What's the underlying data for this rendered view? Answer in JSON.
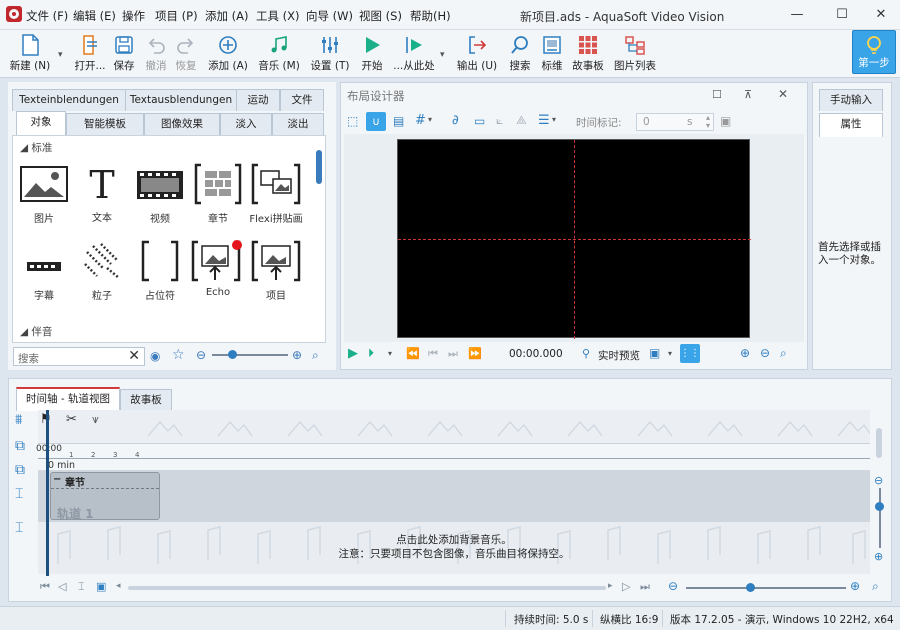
{
  "menu": [
    "文件 (F)",
    "编辑 (E)",
    "操作",
    "项目 (P)",
    "添加 (A)",
    "工具 (X)",
    "向导 (W)",
    "视图 (S)",
    "帮助(H)"
  ],
  "window_title": "新项目.ads - AquaSoft Video Vision",
  "toolbar": {
    "new": "新建 (N)",
    "open": "打开...",
    "save": "保存",
    "undo": "撤消",
    "redo": "恢复",
    "add": "添加 (A)",
    "music": "音乐 (M)",
    "settings": "设置 (T)",
    "start": "开始",
    "from_here": "...从此处",
    "export": "输出 (U)",
    "search": "搜索",
    "marker": "标维",
    "storyboard": "故事板",
    "photo_list": "图片列表",
    "first_step": "第一步"
  },
  "objects_panel": {
    "top_tabs": [
      "Texteinblendungen",
      "Textausblendungen",
      "运动",
      "文件"
    ],
    "bottom_tabs": [
      "对象",
      "智能模板",
      "图像效果",
      "淡入",
      "淡出"
    ],
    "section_standard": "标准",
    "items": [
      "图片",
      "文本",
      "视频",
      "章节",
      "Flexi拼贴画",
      "字幕",
      "粒子",
      "占位符",
      "Echo",
      "项目"
    ],
    "section_music": "伴音",
    "search_placeholder": "搜索"
  },
  "layout_designer": {
    "title": "布局设计器",
    "time_marker_label": "时间标记:",
    "time_marker_value": "0",
    "time_unit": "s",
    "timecode": "00:00.000",
    "realtime_preview": "实时预览"
  },
  "right_panel": {
    "tab_manual": "手动输入",
    "tab_properties": "属性",
    "hint": "首先选择或插入一个对象。"
  },
  "timeline": {
    "tab_timeline": "时间轴 - 轨道视图",
    "tab_storyboard": "故事板",
    "time_start": "00:00",
    "min_label": "0 min",
    "ticks": [
      "1",
      "2",
      "3",
      "4"
    ],
    "chapter_label": "章节",
    "track_label": "轨道 1",
    "music_hint_1": "点击此处添加背景音乐。",
    "music_hint_2": "注意：只要项目不包含图像，音乐曲目将保持空。"
  },
  "status": {
    "duration": "持续时间: 5.0 s",
    "aspect": "纵横比 16:9",
    "version": "版本 17.2.05 - 演示, Windows 10 22H2, x64"
  },
  "colors": {
    "accent": "#3aa4e8",
    "icon": "#2f7fc0",
    "green": "#19a37d"
  }
}
